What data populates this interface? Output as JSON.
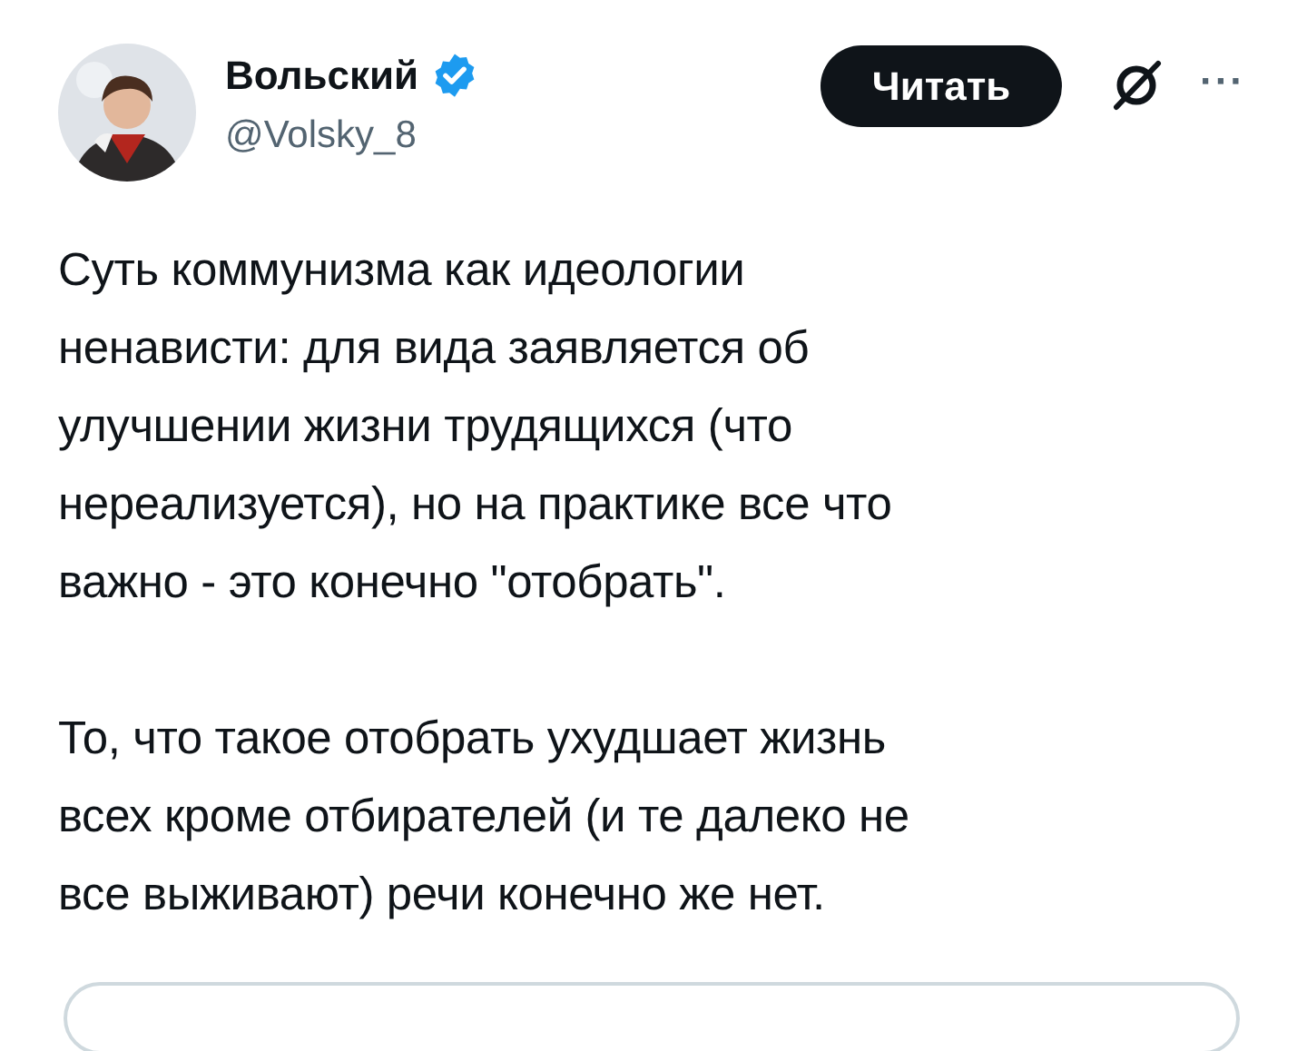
{
  "author": {
    "name": "Вольский",
    "verified": true,
    "handle": "@Volsky_8"
  },
  "follow_button": "Читать",
  "more": "···",
  "body": [
    [
      "Суть коммунизма как идеологии",
      "ненависти: для вида заявляется об",
      "улучшении жизни трудящихся (что",
      "нереализуется), но на практике все что",
      "важно - это конечно \"отобрать\"."
    ],
    [
      "То, что такое отобрать ухудшает жизнь",
      "всех кроме отбирателей (и те далеко не",
      "все выживают) речи конечно же нет."
    ]
  ]
}
